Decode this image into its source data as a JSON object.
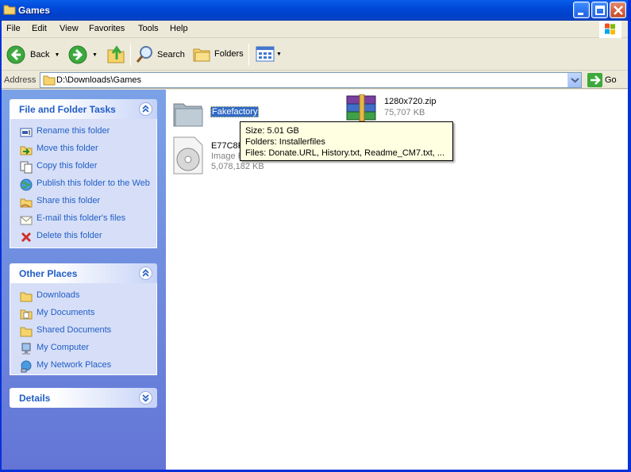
{
  "window": {
    "title": "Games"
  },
  "menu": [
    "File",
    "Edit",
    "View",
    "Favorites",
    "Tools",
    "Help"
  ],
  "toolbar": {
    "back_label": "Back",
    "search_label": "Search",
    "folders_label": "Folders"
  },
  "address": {
    "label": "Address",
    "path": "D:\\Downloads\\Games",
    "go_label": "Go"
  },
  "tasks_panel": {
    "title": "File and Folder Tasks",
    "items": [
      {
        "label": "Rename this folder",
        "icon": "rename-icon"
      },
      {
        "label": "Move this folder",
        "icon": "move-icon"
      },
      {
        "label": "Copy this folder",
        "icon": "copy-icon"
      },
      {
        "label": "Publish this folder to the Web",
        "icon": "globe-icon"
      },
      {
        "label": "Share this folder",
        "icon": "share-icon"
      },
      {
        "label": "E-mail this folder's files",
        "icon": "email-icon"
      },
      {
        "label": "Delete this folder",
        "icon": "delete-icon"
      }
    ]
  },
  "places_panel": {
    "title": "Other Places",
    "items": [
      {
        "label": "Downloads",
        "icon": "folder-icon"
      },
      {
        "label": "My Documents",
        "icon": "my-documents-icon"
      },
      {
        "label": "Shared Documents",
        "icon": "folder-icon"
      },
      {
        "label": "My Computer",
        "icon": "computer-icon"
      },
      {
        "label": "My Network Places",
        "icon": "network-icon"
      }
    ]
  },
  "details_panel": {
    "title": "Details"
  },
  "files": [
    {
      "name": "Fakefactory",
      "type": "folder",
      "selected": true
    },
    {
      "name": "1280x720.zip",
      "size": "75,707 KB",
      "type": "zip"
    },
    {
      "name": "E77C8F",
      "subtype": "Image F",
      "size": "5,078,182 KB",
      "type": "disc-image"
    }
  ],
  "tooltip": {
    "size": "Size: 5.01 GB",
    "folders": "Folders: Installerfiles",
    "files": "Files: Donate.URL, History.txt, Readme_CM7.txt, ..."
  },
  "colors": {
    "title_bar": "#0048D8",
    "selection": "#316AC5",
    "task_link": "#215DC6",
    "tooltip_bg": "#FFFFE1"
  }
}
